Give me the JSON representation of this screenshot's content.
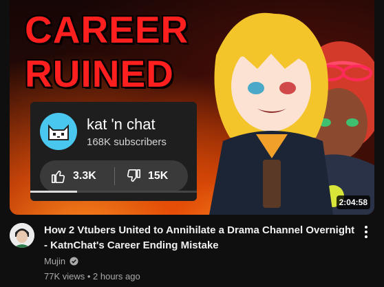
{
  "thumbnail": {
    "headline_line1": "CAREER",
    "headline_line2": "RUINED",
    "duration": "2:04:58",
    "watch_progress_fraction": 0.28
  },
  "channel_card": {
    "name": "kat 'n chat",
    "subscribers": "168K subscribers",
    "likes": "3.3K",
    "dislikes": "15K"
  },
  "video": {
    "title": "How 2 Vtubers United to Annihilate a Drama Channel Overnight - KatnChat's Career Ending Mistake",
    "channel": "Mujin",
    "verified_icon": "check-circle-icon",
    "stats": "77K views • 2 hours ago"
  },
  "colors": {
    "headline_red": "#ff1f1f",
    "card_bg": "#1e1e1e",
    "page_bg": "#0f0f0f"
  }
}
